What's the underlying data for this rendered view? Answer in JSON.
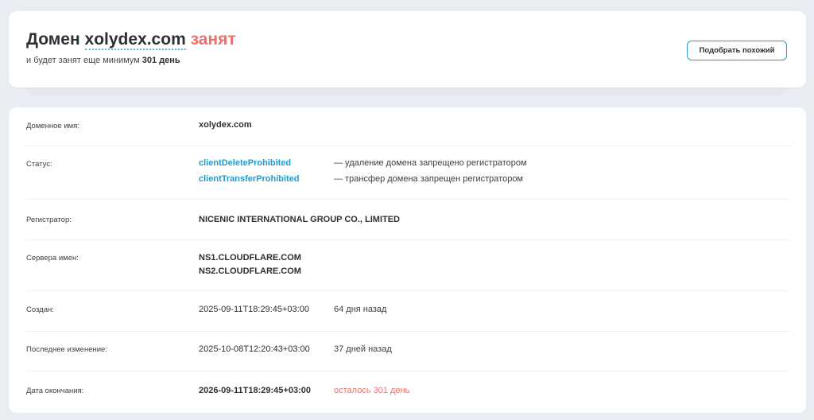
{
  "header": {
    "prefix": "Домен",
    "domain": "xolydex.com",
    "state": "занят",
    "sub_prefix": "и будет занят еще минимум",
    "sub_days": "301 день",
    "similar_button": "Подобрать похожий"
  },
  "details": {
    "domain_name": {
      "label": "Доменное имя:",
      "value": "xolydex.com"
    },
    "status": {
      "label": "Статус:",
      "items": [
        {
          "code": "clientDeleteProhibited",
          "desc": "— удаление домена запрещено регистратором"
        },
        {
          "code": "clientTransferProhibited",
          "desc": "— трансфер домена запрещен регистратором"
        }
      ]
    },
    "registrar": {
      "label": "Регистратор:",
      "value": "NICENIC INTERNATIONAL GROUP CO., LIMITED"
    },
    "nameservers": {
      "label": "Сервера имен:",
      "values": [
        "NS1.CLOUDFLARE.COM",
        "NS2.CLOUDFLARE.COM"
      ]
    },
    "created": {
      "label": "Создан:",
      "value": "2025-09-11T18:29:45+03:00",
      "ago": "64 дня назад"
    },
    "updated": {
      "label": "Последнее изменение:",
      "value": "2025-10-08T12:20:43+03:00",
      "ago": "37 дней назад"
    },
    "expires": {
      "label": "Дата окончания:",
      "value": "2026-09-11T18:29:45+03:00",
      "remaining": "осталось 301 день"
    }
  },
  "colors": {
    "accent": "#1e9ccf",
    "busy": "#ef6f6c",
    "background": "#e9edf2"
  }
}
